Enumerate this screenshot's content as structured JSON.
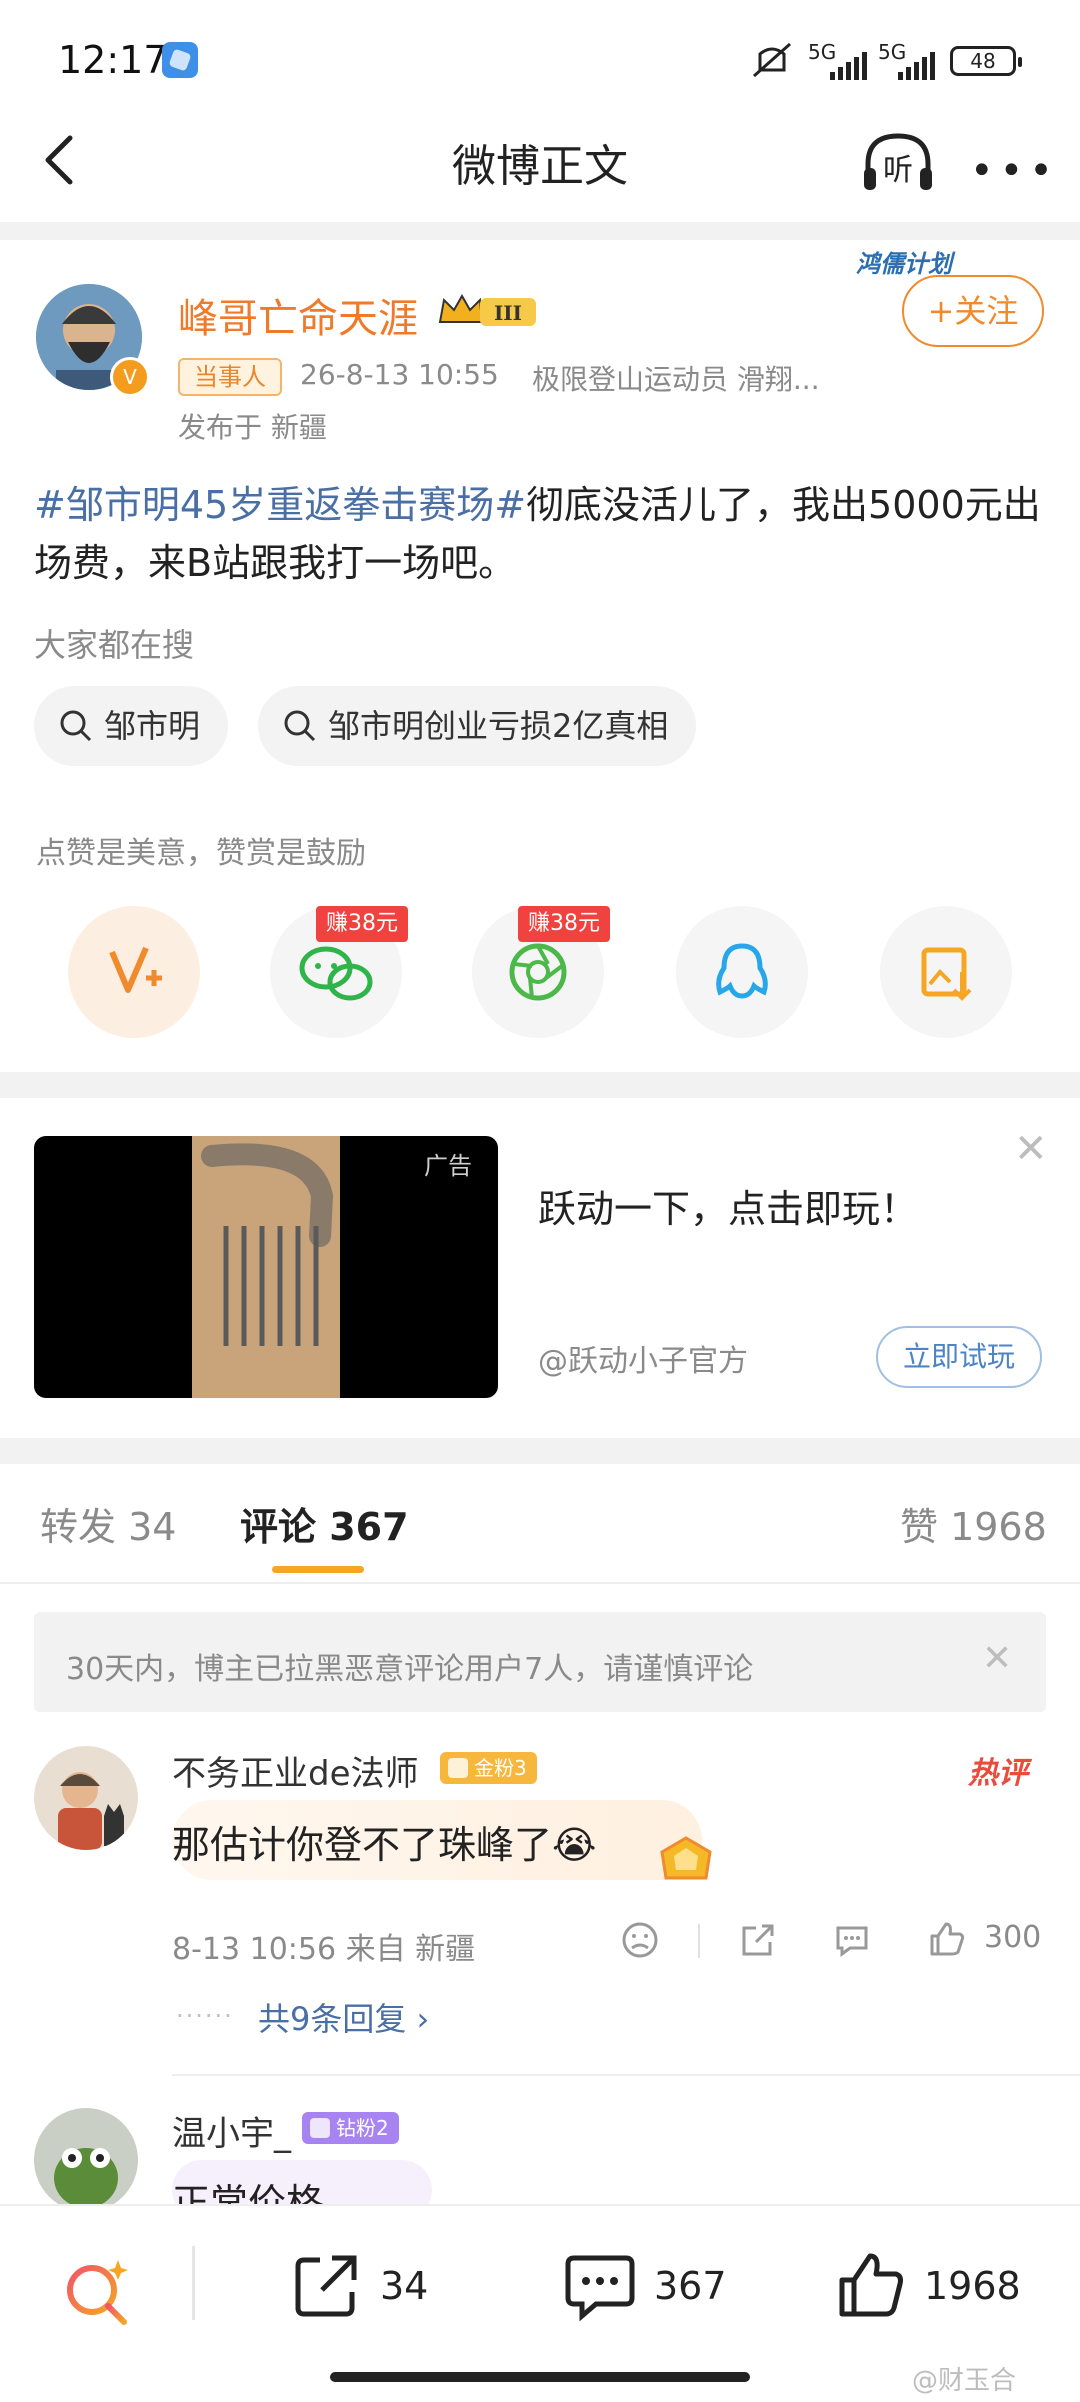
{
  "status_bar": {
    "time": "12:17",
    "net1": "5G",
    "net2": "5G",
    "battery": "48"
  },
  "nav": {
    "title": "微博正文"
  },
  "post": {
    "username": "峰哥亡命天涯",
    "plan_badge": "鸿儒计划",
    "follow_label": "+关注",
    "role_tag": "当事人",
    "timestamp": "26-8-13 10:55",
    "user_desc": "极限登山运动员 滑翔...",
    "location": "发布于 新疆",
    "hashtag": "#邹市明45岁重返拳击赛场#",
    "body": "彻底没活儿了，我出5000元出场费，来B站跟我打一场吧。",
    "search_label": "大家都在搜",
    "search_chips": [
      "邹市明",
      "邹市明创业亏损2亿真相"
    ],
    "reward_label": "点赞是美意，赞赏是鼓励",
    "earn_badges": [
      "赚38元",
      "赚38元"
    ]
  },
  "ad": {
    "tag": "广告",
    "title": "跃动一下，点击即玩！",
    "source": "@跃动小子官方",
    "button": "立即试玩"
  },
  "tabs": {
    "repost": "转发 34",
    "comment": "评论 367",
    "like": "赞 1968"
  },
  "notice": "30天内，博主已拉黑恶意评论用户7人，请谨慎评论",
  "comments": [
    {
      "name": "不务正业de法师",
      "fan_badge": "金粉3",
      "hot": "热评",
      "text": "那估计你登不了珠峰了😭",
      "meta": "8-13 10:56  来自 新疆",
      "likes": "300",
      "replies": "共9条回复 ›"
    },
    {
      "name": "温小宇_",
      "fan_badge": "钻粉2",
      "text": "正常价格"
    }
  ],
  "bottom_bar": {
    "repost": "34",
    "comment": "367",
    "like": "1968"
  },
  "watermark": "@财玉合"
}
